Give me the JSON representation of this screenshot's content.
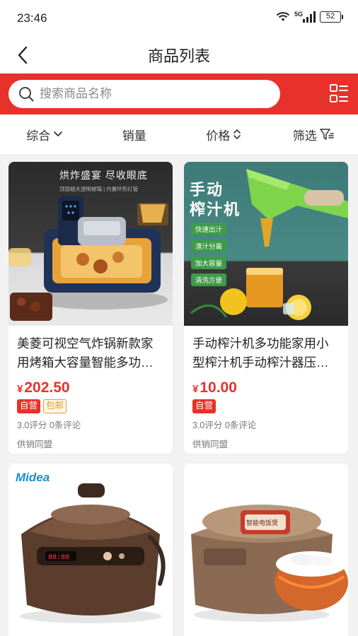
{
  "status_bar": {
    "time": "23:46",
    "network": "5G",
    "battery": "52"
  },
  "nav": {
    "title": "商品列表"
  },
  "search": {
    "placeholder": "搜索商品名称"
  },
  "sort_bar": {
    "items": [
      "综合",
      "销量",
      "价格",
      "筛选"
    ]
  },
  "products": [
    {
      "name": "美菱可视空气炸锅新款家用烤箱大容量智能多功能电炸锅",
      "currency": "¥",
      "price": "202.50",
      "badges": [
        "自营",
        "包邮"
      ],
      "rating": "3.0评分 0条评论",
      "seller": "供销同盟",
      "image_text": {
        "headline": "烘炸盛宴 尽收眼底",
        "subline": "顶部超大透明玻璃 | 内置环形灯管"
      }
    },
    {
      "name": "手动榨汁机多功能家用小型榨汁机手动榨汁器压汁机",
      "currency": "¥",
      "price": "10.00",
      "badges": [
        "自营"
      ],
      "rating": "3.0评分 0条评论",
      "seller": "供销同盟",
      "image_text": {
        "title_line1": "手动",
        "title_line2": "榨汁机",
        "features": [
          "快速出汁",
          "渣汁分离",
          "加大容量",
          "清洗方便"
        ]
      }
    },
    {
      "name": "",
      "image_text": {
        "brand": "Midea"
      }
    },
    {
      "name": "",
      "image_text": {
        "label": "智能电饭煲"
      }
    }
  ],
  "colors": {
    "brand_red": "#e8312a",
    "price_red": "#e8312a",
    "badge_orange": "#e39c2a",
    "page_bg": "#f2f2f2"
  }
}
